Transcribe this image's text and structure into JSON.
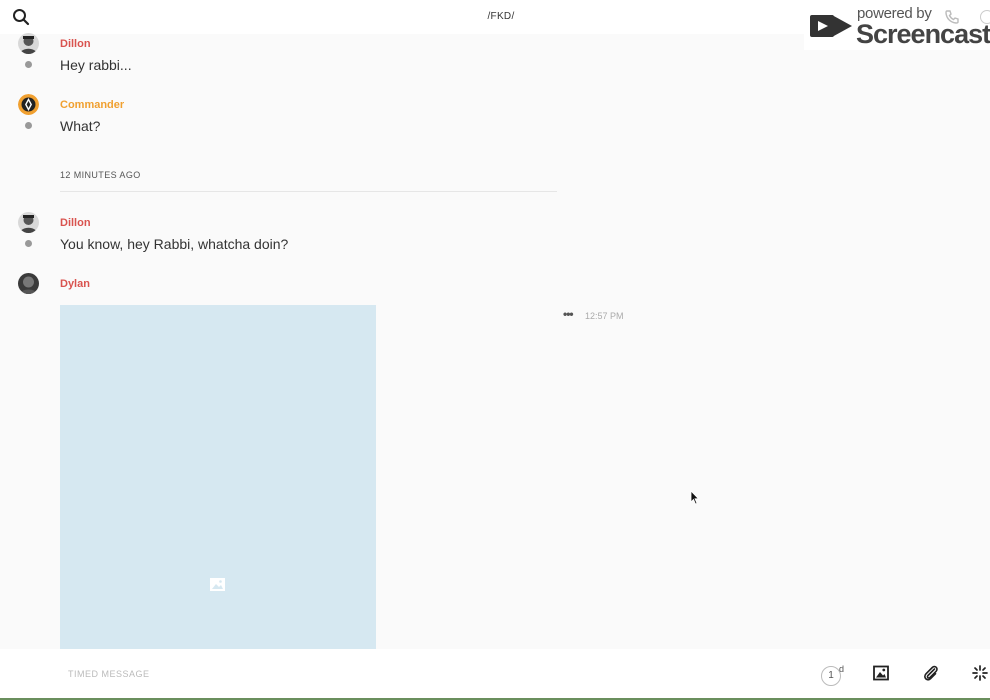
{
  "header": {
    "title": "/FKD/",
    "search_icon": "search-icon"
  },
  "watermark": {
    "powered_by": "powered by",
    "brand": "Screencastify"
  },
  "messages": [
    {
      "author": "Dillon",
      "author_color": "#d9534f",
      "text": "Hey rabbi...",
      "avatar": "dillon-avatar"
    },
    {
      "author": "Commander",
      "author_color": "#f0a030",
      "text": "What?",
      "avatar": "commander-avatar"
    },
    {
      "author": "Dillon",
      "author_color": "#d9534f",
      "text": "You know, hey Rabbi, whatcha doin?",
      "avatar": "dillon-avatar"
    },
    {
      "author": "Dylan",
      "author_color": "#d9534f",
      "avatar": "dylan-avatar",
      "attachment": "image",
      "time": "12:57 PM",
      "more_icon": "•••"
    }
  ],
  "divider": {
    "label": "12 MINUTES AGO"
  },
  "composer": {
    "placeholder": "TIMED MESSAGE",
    "timer_value": "1",
    "timer_unit": "d",
    "icons": [
      "timer-icon",
      "image-icon",
      "paperclip-icon",
      "sparkle-icon"
    ]
  },
  "colors": {
    "accent_red": "#d9534f",
    "accent_orange": "#f0a030",
    "image_placeholder": "#d6e8f1"
  }
}
